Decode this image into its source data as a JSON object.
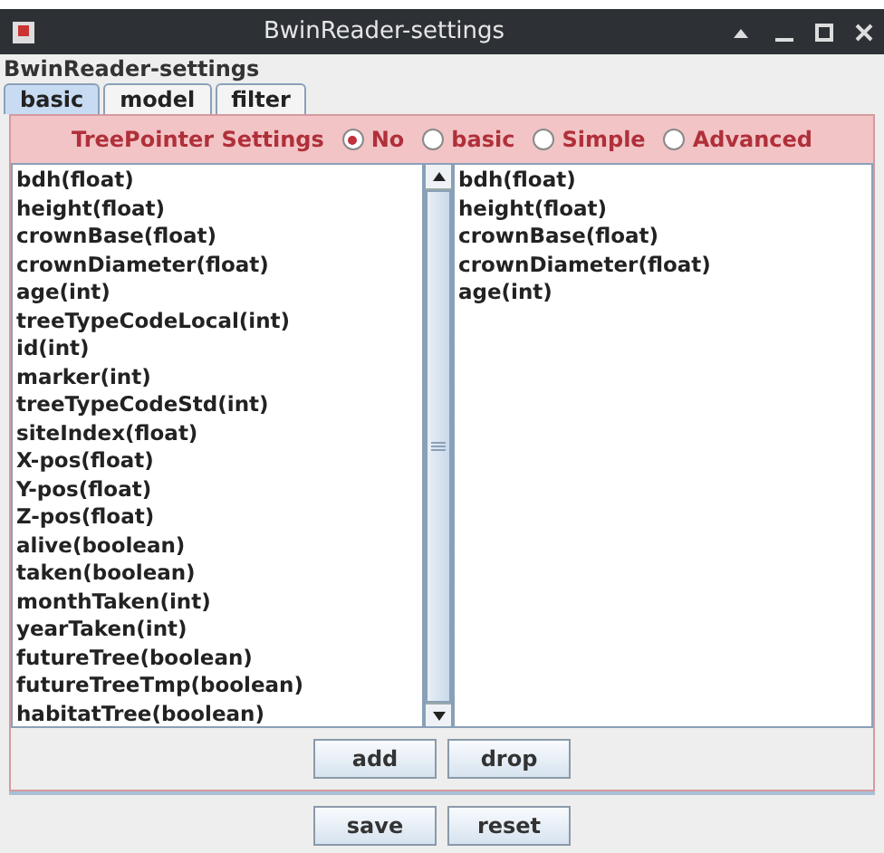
{
  "window": {
    "title": "BwinReader-settings"
  },
  "header": "BwinReader-settings",
  "tabs": [
    {
      "label": "basic",
      "selected": true
    },
    {
      "label": "model",
      "selected": false
    },
    {
      "label": "filter",
      "selected": false
    }
  ],
  "tree_pointer": {
    "label": "TreePointer Settings",
    "options": [
      {
        "label": "No",
        "selected": true
      },
      {
        "label": "basic",
        "selected": false
      },
      {
        "label": "Simple",
        "selected": false
      },
      {
        "label": "Advanced",
        "selected": false
      }
    ]
  },
  "available_fields": [
    "bdh(float)",
    "height(float)",
    "crownBase(float)",
    "crownDiameter(float)",
    "age(int)",
    "treeTypeCodeLocal(int)",
    "id(int)",
    "marker(int)",
    "treeTypeCodeStd(int)",
    "siteIndex(float)",
    "X-pos(float)",
    "Y-pos(float)",
    "Z-pos(float)",
    "alive(boolean)",
    "taken(boolean)",
    "monthTaken(int)",
    "yearTaken(int)",
    "futureTree(boolean)",
    "futureTreeTmp(boolean)",
    "habitatTree(boolean)"
  ],
  "selected_fields": [
    "bdh(float)",
    "height(float)",
    "crownBase(float)",
    "crownDiameter(float)",
    "age(int)"
  ],
  "list_buttons": [
    "add",
    "drop"
  ],
  "buttons": [
    "save",
    "reset"
  ]
}
